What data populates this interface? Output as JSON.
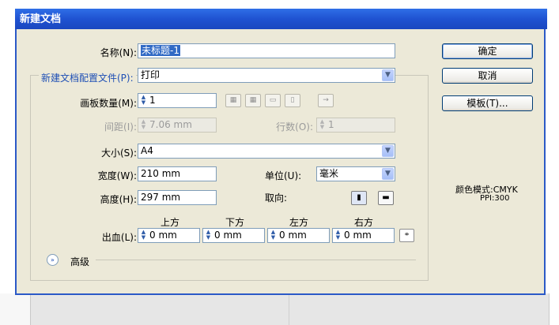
{
  "dialog": {
    "title": "新建文档",
    "name_label": "名称(N):",
    "name_value": "未标题-1",
    "profile_label": "新建文档配置文件(P):",
    "profile_value": "打印",
    "artboards_label": "画板数量(M):",
    "artboards_value": "1",
    "spacing_label": "间距(I):",
    "spacing_value": "7.06 mm",
    "rows_label": "行数(O):",
    "rows_value": "1",
    "size_label": "大小(S):",
    "size_value": "A4",
    "width_label": "宽度(W):",
    "width_value": "210 mm",
    "units_label": "单位(U):",
    "units_value": "毫米",
    "height_label": "高度(H):",
    "height_value": "297 mm",
    "orientation_label": "取向:",
    "bleed_label": "出血(L):",
    "bleed_headers": [
      "上方",
      "下方",
      "左方",
      "右方"
    ],
    "bleed_values": [
      "0 mm",
      "0 mm",
      "0 mm",
      "0 mm"
    ],
    "advanced_label": "高级",
    "ok_button": "确定",
    "cancel_button": "取消",
    "template_button": "模板(T)...",
    "color_mode": "颜色模式:CMYK",
    "ppi": "PPI:300"
  }
}
